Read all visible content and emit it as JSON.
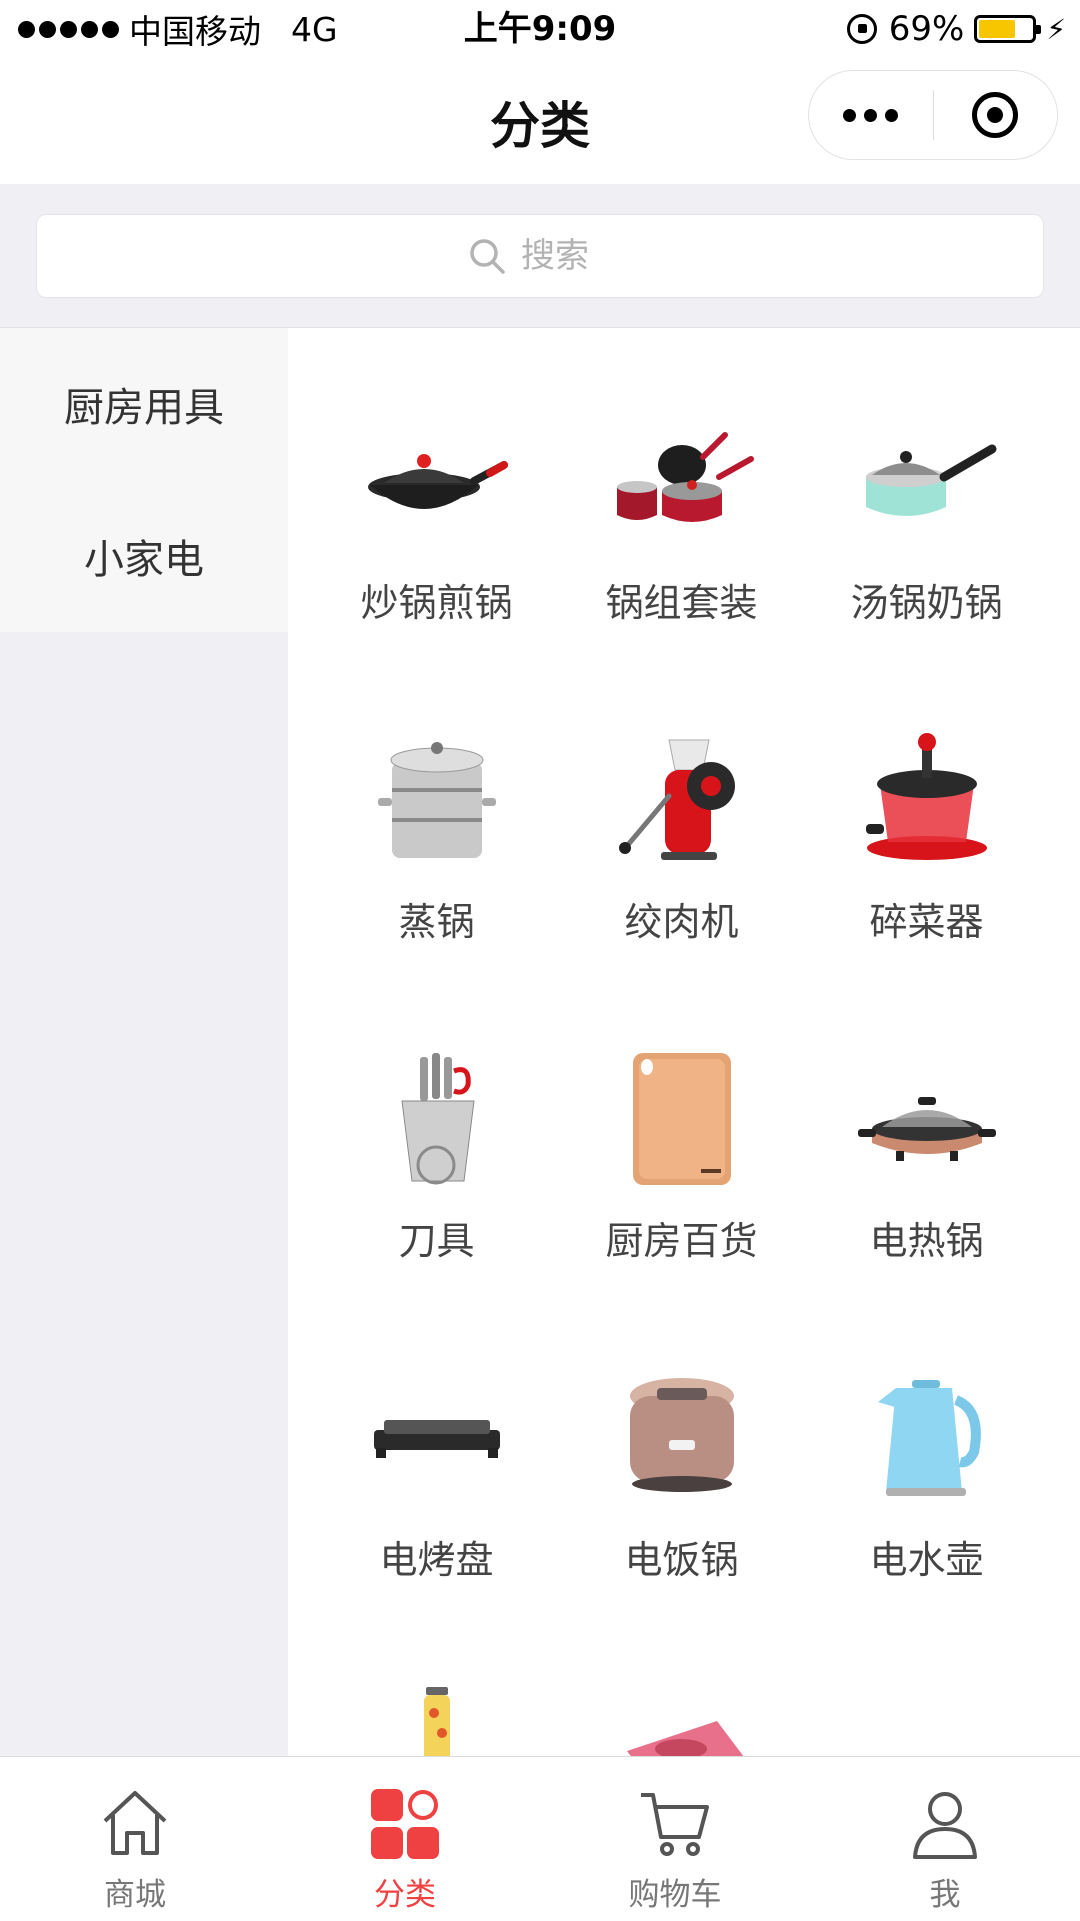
{
  "status_bar": {
    "carrier": "中国移动",
    "network": "4G",
    "time": "上午9:09",
    "battery": "69%",
    "battery_level": 0.69
  },
  "nav": {
    "title": "分类"
  },
  "search": {
    "placeholder": "搜索"
  },
  "sidebar": {
    "items": [
      {
        "label": "厨房用具"
      },
      {
        "label": "小家电"
      }
    ]
  },
  "categories": [
    {
      "label": "炒锅煎锅",
      "icon": "wok-icon"
    },
    {
      "label": "锅组套装",
      "icon": "cookware-set-icon"
    },
    {
      "label": "汤锅奶锅",
      "icon": "saucepan-icon"
    },
    {
      "label": "蒸锅",
      "icon": "steamer-icon"
    },
    {
      "label": "绞肉机",
      "icon": "meat-grinder-icon"
    },
    {
      "label": "碎菜器",
      "icon": "vegetable-chopper-icon"
    },
    {
      "label": "刀具",
      "icon": "knife-block-icon"
    },
    {
      "label": "厨房百货",
      "icon": "cutting-board-icon"
    },
    {
      "label": "电热锅",
      "icon": "electric-pot-icon"
    },
    {
      "label": "电烤盘",
      "icon": "grill-plate-icon"
    },
    {
      "label": "电饭锅",
      "icon": "rice-cooker-icon"
    },
    {
      "label": "电水壶",
      "icon": "kettle-icon"
    }
  ],
  "tabs": [
    {
      "label": "商城",
      "icon": "home-icon"
    },
    {
      "label": "分类",
      "icon": "category-icon"
    },
    {
      "label": "购物车",
      "icon": "cart-icon"
    },
    {
      "label": "我",
      "icon": "user-icon"
    }
  ],
  "colors": {
    "accent": "#f04142",
    "page_bg": "#efeff4",
    "battery_fill": "#f7c600"
  }
}
